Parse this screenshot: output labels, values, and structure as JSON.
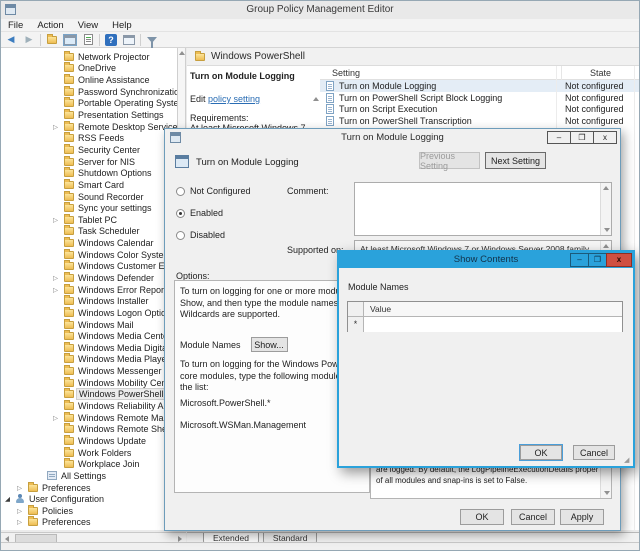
{
  "window": {
    "title": "Group Policy Management Editor"
  },
  "menu_bar": {
    "items": [
      {
        "label": "File"
      },
      {
        "label": "Action"
      },
      {
        "label": "View"
      },
      {
        "label": "Help"
      }
    ]
  },
  "toolbar": {
    "icons": [
      "back",
      "forward",
      "up-one-level",
      "show-console-tree",
      "export-list",
      "help",
      "properties-window",
      "filter"
    ]
  },
  "tree": {
    "items": [
      {
        "label": "Network Projector",
        "level": 3,
        "icon": "folder"
      },
      {
        "label": "OneDrive",
        "level": 3,
        "icon": "folder"
      },
      {
        "label": "Online Assistance",
        "level": 3,
        "icon": "folder"
      },
      {
        "label": "Password Synchronization",
        "level": 3,
        "icon": "folder"
      },
      {
        "label": "Portable Operating System",
        "level": 3,
        "icon": "folder"
      },
      {
        "label": "Presentation Settings",
        "level": 3,
        "icon": "folder"
      },
      {
        "label": "Remote Desktop Services",
        "level": 3,
        "icon": "folder",
        "marker": "collapsed"
      },
      {
        "label": "RSS Feeds",
        "level": 3,
        "icon": "folder"
      },
      {
        "label": "Security Center",
        "level": 3,
        "icon": "folder"
      },
      {
        "label": "Server for NIS",
        "level": 3,
        "icon": "folder"
      },
      {
        "label": "Shutdown Options",
        "level": 3,
        "icon": "folder"
      },
      {
        "label": "Smart Card",
        "level": 3,
        "icon": "folder"
      },
      {
        "label": "Sound Recorder",
        "level": 3,
        "icon": "folder"
      },
      {
        "label": "Sync your settings",
        "level": 3,
        "icon": "folder"
      },
      {
        "label": "Tablet PC",
        "level": 3,
        "icon": "folder",
        "marker": "collapsed"
      },
      {
        "label": "Task Scheduler",
        "level": 3,
        "icon": "folder"
      },
      {
        "label": "Windows Calendar",
        "level": 3,
        "icon": "folder"
      },
      {
        "label": "Windows Color System",
        "level": 3,
        "icon": "folder"
      },
      {
        "label": "Windows Customer Experi",
        "level": 3,
        "icon": "folder"
      },
      {
        "label": "Windows Defender",
        "level": 3,
        "icon": "folder",
        "marker": "collapsed"
      },
      {
        "label": "Windows Error Reporting",
        "level": 3,
        "icon": "folder",
        "marker": "collapsed"
      },
      {
        "label": "Windows Installer",
        "level": 3,
        "icon": "folder"
      },
      {
        "label": "Windows Logon Options",
        "level": 3,
        "icon": "folder"
      },
      {
        "label": "Windows Mail",
        "level": 3,
        "icon": "folder"
      },
      {
        "label": "Windows Media Center",
        "level": 3,
        "icon": "folder"
      },
      {
        "label": "Windows Media Digital Ri",
        "level": 3,
        "icon": "folder"
      },
      {
        "label": "Windows Media Player",
        "level": 3,
        "icon": "folder"
      },
      {
        "label": "Windows Messenger",
        "level": 3,
        "icon": "folder"
      },
      {
        "label": "Windows Mobility Center",
        "level": 3,
        "icon": "folder"
      },
      {
        "label": "Windows PowerShell",
        "level": 3,
        "icon": "folder",
        "selected": true
      },
      {
        "label": "Windows Reliability Analy",
        "level": 3,
        "icon": "folder"
      },
      {
        "label": "Windows Remote Manage",
        "level": 3,
        "icon": "folder",
        "marker": "collapsed"
      },
      {
        "label": "Windows Remote Shell",
        "level": 3,
        "icon": "folder"
      },
      {
        "label": "Windows Update",
        "level": 3,
        "icon": "folder"
      },
      {
        "label": "Work Folders",
        "level": 3,
        "icon": "folder"
      },
      {
        "label": "Workplace Join",
        "level": 3,
        "icon": "folder"
      },
      {
        "label": "All Settings",
        "level": 2,
        "icon": "settings"
      },
      {
        "label": "Preferences",
        "level": 1,
        "icon": "folder",
        "marker": "collapsed"
      },
      {
        "label": "User Configuration",
        "level": 0,
        "icon": "user",
        "marker": "expanded"
      },
      {
        "label": "Policies",
        "level": 1,
        "icon": "folder",
        "marker": "collapsed"
      },
      {
        "label": "Preferences",
        "level": 1,
        "icon": "folder",
        "marker": "collapsed"
      }
    ]
  },
  "content": {
    "header": {
      "title": "Windows PowerShell"
    },
    "description": {
      "title": "Turn on Module Logging",
      "edit_prefix": "Edit ",
      "edit_link": "policy setting",
      "requirements_label": "Requirements:",
      "requirements_text": "At least Microsoft Windows 7 or"
    },
    "settings_table": {
      "columns": {
        "setting": "Setting",
        "state": "State"
      },
      "rows": [
        {
          "setting": "Turn on Module Logging",
          "state": "Not configured",
          "selected": true
        },
        {
          "setting": "Turn on PowerShell Script Block Logging",
          "state": "Not configured"
        },
        {
          "setting": "Turn on Script Execution",
          "state": "Not configured"
        },
        {
          "setting": "Turn on PowerShell Transcription",
          "state": "Not configured"
        }
      ]
    },
    "tabs": [
      {
        "label": "Extended",
        "active": true
      },
      {
        "label": "Standard"
      }
    ]
  },
  "module_dialog": {
    "title": "Turn on Module Logging",
    "setting_name": "Turn on Module Logging",
    "previous_button": "Previous Setting",
    "next_button": "Next Setting",
    "radios": [
      {
        "label": "Not Configured"
      },
      {
        "label": "Enabled",
        "selected": true
      },
      {
        "label": "Disabled"
      }
    ],
    "comment_label": "Comment:",
    "supported_label": "Supported on:",
    "supported_value": "At least Microsoft Windows 7 or Windows Server 2008 family",
    "options_label": "Options:",
    "options_lines": [
      "To turn on logging for one or more modules, click",
      "Show, and then type the module names in the list.",
      "Wildcards are supported."
    ],
    "module_names_label": "Module Names",
    "show_button": "Show...",
    "options_lines2": [
      "To turn on logging for the Windows PowerShell",
      "core modules, type the following module names in",
      "the list:"
    ],
    "module_examples": [
      "Microsoft.PowerShell.*",
      "Microsoft.WSMan.Management"
    ],
    "help_lines": [
      "are logged. By default, the LogPipelineExecutionDetails property",
      "of all modules and snap-ins is set to False."
    ],
    "ok_button": "OK",
    "cancel_button": "Cancel",
    "apply_button": "Apply",
    "minimize_glyph": "–",
    "maximize_glyph": "❐",
    "close_glyph": "x"
  },
  "show_contents_dialog": {
    "title": "Show Contents",
    "module_names_label": "Module Names",
    "value_column": "Value",
    "new_row_marker": "*",
    "ok_button": "OK",
    "cancel_button": "Cancel",
    "minimize_glyph": "–",
    "maximize_glyph": "❐",
    "close_glyph": "x"
  },
  "colors": {
    "active_titlebar": "#2aa2db",
    "close_button": "#cf5042",
    "link": "#2a6db4",
    "selected_row": "#e4edf6"
  }
}
